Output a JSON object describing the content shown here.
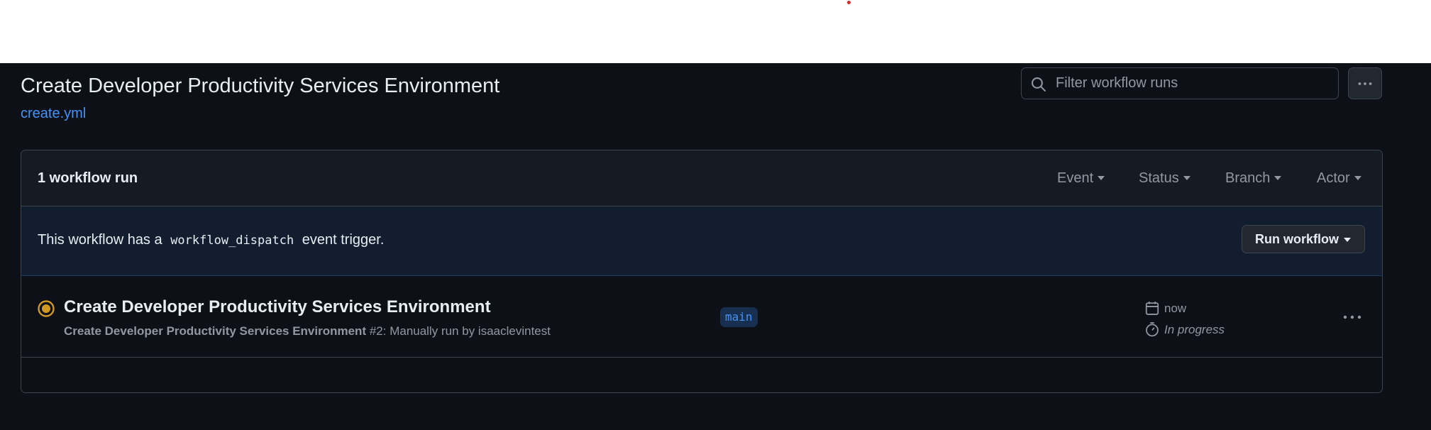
{
  "workflow": {
    "title": "Create Developer Productivity Services Environment",
    "file_link": "create.yml"
  },
  "search": {
    "placeholder": "Filter workflow runs"
  },
  "runs_header": {
    "count_label": "1 workflow run",
    "filters": [
      "Event",
      "Status",
      "Branch",
      "Actor"
    ]
  },
  "dispatch_banner": {
    "text_before": "This workflow has a",
    "code": "workflow_dispatch",
    "text_after": "event trigger.",
    "run_button_label": "Run workflow"
  },
  "runs": [
    {
      "title": "Create Developer Productivity Services Environment",
      "workflow_name": "Create Developer Productivity Services Environment",
      "detail": "#2: Manually run by isaaclevintest",
      "branch": "main",
      "time": "now",
      "status": "In progress",
      "status_icon": "in-progress-icon",
      "status_color": "#d29922"
    }
  ],
  "colors": {
    "background": "#0d1117",
    "link": "#4493f8",
    "banner": "#121d2f"
  }
}
